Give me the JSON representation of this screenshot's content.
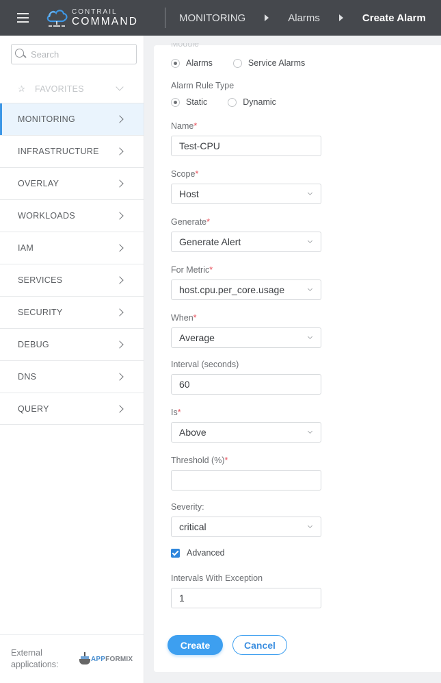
{
  "header": {
    "logo": {
      "line1": "CONTRAIL",
      "line2": "COMMAND"
    },
    "breadcrumb": [
      "MONITORING",
      "Alarms",
      "Create Alarm"
    ]
  },
  "sidebar": {
    "search_placeholder": "Search",
    "favorites_label": "FAVORITES",
    "items": [
      {
        "label": "MONITORING",
        "active": true
      },
      {
        "label": "INFRASTRUCTURE"
      },
      {
        "label": "OVERLAY"
      },
      {
        "label": "WORKLOADS"
      },
      {
        "label": "IAM"
      },
      {
        "label": "SERVICES"
      },
      {
        "label": "SECURITY"
      },
      {
        "label": "DEBUG"
      },
      {
        "label": "DNS"
      },
      {
        "label": "QUERY"
      }
    ],
    "footer": {
      "label": "External applications:",
      "app_name_prefix": "APP",
      "app_name_suffix": "FORMIX"
    }
  },
  "form": {
    "module": {
      "label": "Module",
      "options": [
        "Alarms",
        "Service Alarms"
      ],
      "selected": "Alarms"
    },
    "rule_type": {
      "label": "Alarm Rule Type",
      "options": [
        "Static",
        "Dynamic"
      ],
      "selected": "Static"
    },
    "name": {
      "label": "Name",
      "value": "Test-CPU"
    },
    "scope": {
      "label": "Scope",
      "value": "Host"
    },
    "generate": {
      "label": "Generate",
      "value": "Generate Alert"
    },
    "metric": {
      "label": "For Metric",
      "value": "host.cpu.per_core.usage"
    },
    "when": {
      "label": "When",
      "value": "Average"
    },
    "interval": {
      "label": "Interval (seconds)",
      "value": "60"
    },
    "is": {
      "label": "Is",
      "value": "Above"
    },
    "threshold": {
      "label": "Threshold (%)",
      "value": ""
    },
    "severity": {
      "label": "Severity:",
      "value": "critical"
    },
    "advanced": {
      "label": "Advanced",
      "checked": true
    },
    "intervals_exception": {
      "label": "Intervals With Exception",
      "value": "1"
    },
    "required_mark": "*",
    "create_label": "Create",
    "cancel_label": "Cancel"
  },
  "colors": {
    "accent": "#3d9ff0",
    "header_bg": "#45484d",
    "required": "#e8505b"
  }
}
